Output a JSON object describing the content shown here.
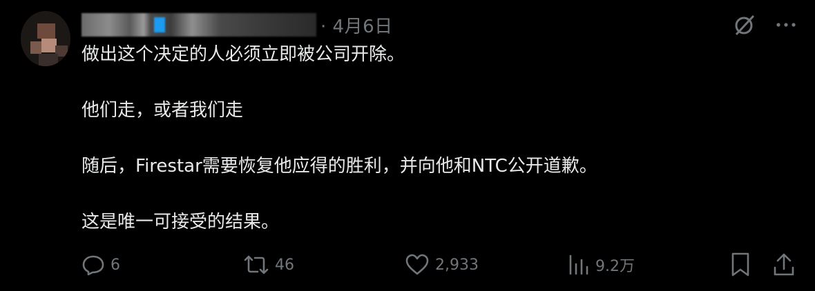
{
  "post": {
    "date": "4月6日",
    "paragraphs": [
      "做出这个决定的人必须立即被公司开除。",
      "他们走，或者我们走",
      "随后，Firestar需要恢复他应得的胜利，并向他和NTC公开道歉。",
      "这是唯一可接受的结果。"
    ],
    "stats": {
      "replies": "6",
      "reposts": "46",
      "likes": "2,933",
      "views": "9.2万"
    }
  },
  "icons": {
    "grok": "grok-slash-icon",
    "more": "more-icon",
    "reply": "reply-icon",
    "repost": "repost-icon",
    "like": "heart-icon",
    "views": "views-icon",
    "bookmark": "bookmark-icon",
    "share": "share-icon"
  },
  "colors": {
    "background": "#000000",
    "text": "#e7e9ea",
    "muted": "#71767b",
    "verified": "#1d9bf0"
  }
}
